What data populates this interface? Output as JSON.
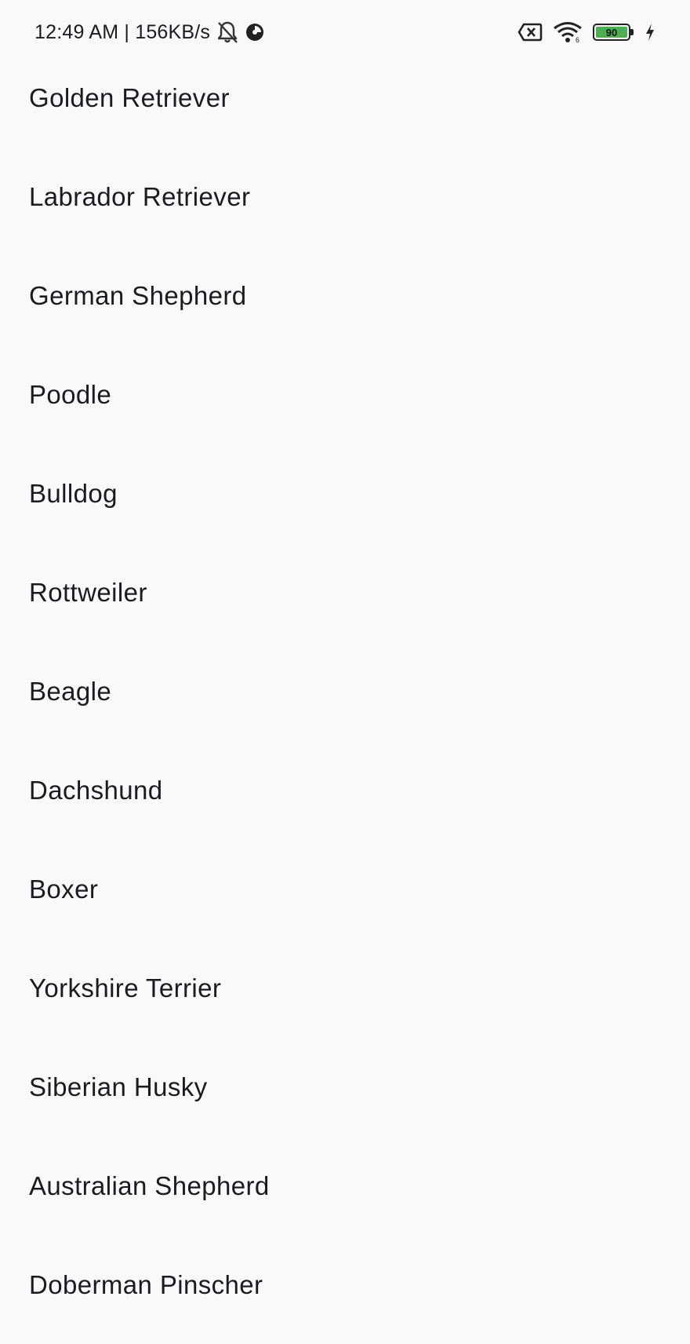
{
  "status_bar": {
    "time_text": "12:49 AM | 156KB/s",
    "battery_level": "90",
    "battery_color": "#4caf50",
    "icons": [
      "bell-off-icon",
      "data-saver-icon",
      "sim-x-icon",
      "wifi-icon",
      "battery-icon",
      "charging-bolt-icon"
    ]
  },
  "breeds": [
    "Golden Retriever",
    "Labrador Retriever",
    "German Shepherd",
    "Poodle",
    "Bulldog",
    "Rottweiler",
    "Beagle",
    "Dachshund",
    "Boxer",
    "Yorkshire Terrier",
    "Siberian Husky",
    "Australian Shepherd",
    "Doberman Pinscher"
  ],
  "colors": {
    "background": "#fbf8fb",
    "text": "#1c1b1f"
  }
}
